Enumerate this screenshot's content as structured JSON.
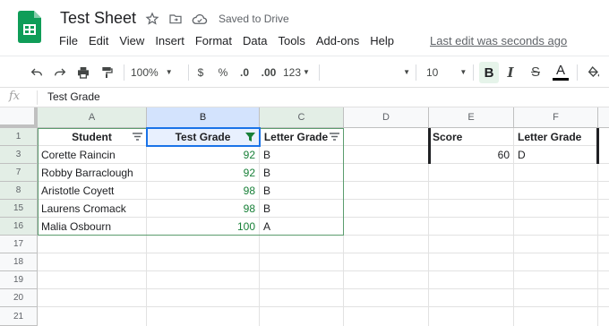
{
  "app": {
    "doc_title": "Test Sheet",
    "save_status": "Saved to Drive",
    "last_edit": "Last edit was seconds ago",
    "menu": [
      "File",
      "Edit",
      "View",
      "Insert",
      "Format",
      "Data",
      "Tools",
      "Add-ons",
      "Help"
    ],
    "brand_color": "#0f9d58"
  },
  "toolbar": {
    "zoom": "100%",
    "currency": "$",
    "percent": "%",
    "dec_less": ".0",
    "dec_more": ".00",
    "more_formats": "123",
    "font_size": "10",
    "bold": "B",
    "strike": "S",
    "text_color": "A"
  },
  "formula_bar": {
    "fx_label": "fx",
    "value": "Test Grade"
  },
  "grid": {
    "columns": [
      "A",
      "B",
      "C",
      "D",
      "E",
      "F"
    ],
    "rows": [
      "1",
      "3",
      "7",
      "8",
      "15",
      "16",
      "17",
      "18",
      "19",
      "20",
      "21"
    ],
    "headers": {
      "a": "Student",
      "b": "Test Grade",
      "c": "Letter Grade",
      "e": "Score",
      "f": "Letter Grade"
    },
    "data": [
      {
        "name": "Corette Raincin",
        "grade": "92",
        "letter": "B"
      },
      {
        "name": "Robby Barraclough",
        "grade": "92",
        "letter": "B"
      },
      {
        "name": "Aristotle Coyett",
        "grade": "98",
        "letter": "B"
      },
      {
        "name": "Laurens Cromack",
        "grade": "98",
        "letter": "B"
      },
      {
        "name": "Malia Osbourn",
        "grade": "100",
        "letter": "A"
      }
    ],
    "lookup": {
      "score": "60",
      "letter": "D"
    },
    "number_color": "#188038",
    "selection_color": "#1a73e8",
    "range_color": "#5b9d6e"
  }
}
